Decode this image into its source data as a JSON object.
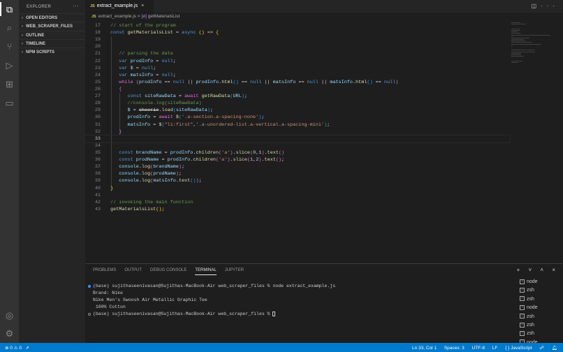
{
  "activity": {
    "items": [
      "explorer",
      "search",
      "source-control",
      "run-debug",
      "extensions",
      "remote"
    ],
    "account": "account",
    "settings": "settings"
  },
  "sidebar": {
    "title": "EXPLORER",
    "more": "···",
    "sections": [
      "OPEN EDITORS",
      "WEB_SCRAPER_FILES",
      "OUTLINE",
      "TIMELINE",
      "NPM SCRIPTS"
    ]
  },
  "tab": {
    "icon": "JS",
    "label": "extract_example.js",
    "close": "×"
  },
  "breadcrumb": {
    "file": "extract_example.js",
    "sep": ">",
    "symbol_icon": "[ø]",
    "symbol": "getMaterialsList"
  },
  "editor": {
    "current_line": 33,
    "lines": [
      {
        "n": "17",
        "t": [
          [
            "c",
            "// start of the program"
          ]
        ]
      },
      {
        "n": "18",
        "t": [
          [
            "k",
            "const "
          ],
          [
            "f",
            "getMaterialsList"
          ],
          [
            "p",
            " = "
          ],
          [
            "k",
            "async "
          ],
          [
            "y",
            "()"
          ],
          [
            "p",
            " => "
          ],
          [
            "y",
            "{"
          ]
        ]
      },
      {
        "n": "19",
        "t": []
      },
      {
        "n": "20",
        "t": []
      },
      {
        "n": "21",
        "t": [
          [
            "p",
            "   "
          ],
          [
            "c",
            "// parsing the data"
          ]
        ]
      },
      {
        "n": "22",
        "t": [
          [
            "p",
            "   "
          ],
          [
            "k",
            "var "
          ],
          [
            "v",
            "prodInfo"
          ],
          [
            "p",
            " = "
          ],
          [
            "k",
            "null"
          ],
          [
            "p",
            ";"
          ]
        ]
      },
      {
        "n": "23",
        "t": [
          [
            "p",
            "   "
          ],
          [
            "k",
            "var "
          ],
          [
            "v",
            "$"
          ],
          [
            "p",
            " = "
          ],
          [
            "k",
            "null"
          ],
          [
            "p",
            ";"
          ]
        ]
      },
      {
        "n": "24",
        "t": [
          [
            "p",
            "   "
          ],
          [
            "k",
            "var "
          ],
          [
            "v",
            "matsInfo"
          ],
          [
            "p",
            " = "
          ],
          [
            "k",
            "null"
          ],
          [
            "p",
            ";"
          ]
        ]
      },
      {
        "n": "25",
        "t": [
          [
            "p",
            "   "
          ],
          [
            "m",
            "while "
          ],
          [
            "m",
            "("
          ],
          [
            "v",
            "prodInfo"
          ],
          [
            "p",
            " == "
          ],
          [
            "k",
            "null"
          ],
          [
            "p",
            " || "
          ],
          [
            "v",
            "prodInfo"
          ],
          [
            "p",
            "."
          ],
          [
            "f",
            "html"
          ],
          [
            "b",
            "()"
          ],
          [
            "p",
            " == "
          ],
          [
            "k",
            "null"
          ],
          [
            "p",
            " || "
          ],
          [
            "v",
            "matsInfo"
          ],
          [
            "p",
            " == "
          ],
          [
            "k",
            "null"
          ],
          [
            "p",
            " || "
          ],
          [
            "v",
            "matsInfo"
          ],
          [
            "p",
            "."
          ],
          [
            "f",
            "html"
          ],
          [
            "b",
            "()"
          ],
          [
            "p",
            " == "
          ],
          [
            "k",
            "null"
          ],
          [
            "m",
            ")"
          ]
        ]
      },
      {
        "n": "26",
        "t": [
          [
            "p",
            "   "
          ],
          [
            "m",
            "{"
          ]
        ]
      },
      {
        "n": "27",
        "t": [
          [
            "p",
            "      "
          ],
          [
            "k",
            "const "
          ],
          [
            "v",
            "siteRawData"
          ],
          [
            "p",
            " = "
          ],
          [
            "m",
            "await "
          ],
          [
            "f",
            "getRawData"
          ],
          [
            "b",
            "("
          ],
          [
            "v",
            "URL"
          ],
          [
            "b",
            ")"
          ],
          [
            "p",
            ";"
          ]
        ]
      },
      {
        "n": "28",
        "t": [
          [
            "p",
            "      "
          ],
          [
            "c",
            "//console.log(siteRawData)"
          ]
        ]
      },
      {
        "n": "29",
        "t": [
          [
            "p",
            "      "
          ],
          [
            "v",
            "$"
          ],
          [
            "p",
            " = "
          ],
          [
            "st",
            "cheerio"
          ],
          [
            "p",
            "."
          ],
          [
            "f",
            "load"
          ],
          [
            "b",
            "("
          ],
          [
            "v",
            "siteRawData"
          ],
          [
            "b",
            ")"
          ],
          [
            "p",
            ";"
          ]
        ]
      },
      {
        "n": "30",
        "t": [
          [
            "p",
            "      "
          ],
          [
            "v",
            "prodInfo"
          ],
          [
            "p",
            " = "
          ],
          [
            "m",
            "await "
          ],
          [
            "f",
            "$"
          ],
          [
            "b",
            "("
          ],
          [
            "s",
            "'.a-section.a-spacing-none'"
          ],
          [
            "b",
            ")"
          ],
          [
            "p",
            ";"
          ]
        ]
      },
      {
        "n": "31",
        "t": [
          [
            "p",
            "      "
          ],
          [
            "v",
            "matsInfo"
          ],
          [
            "p",
            " = "
          ],
          [
            "f",
            "$"
          ],
          [
            "b",
            "("
          ],
          [
            "s",
            "\"li:first\""
          ],
          [
            "p",
            ","
          ],
          [
            "s",
            "'.a-unordered-list.a-vertical.a-spacing-mini'"
          ],
          [
            "b",
            ")"
          ],
          [
            "p",
            ";"
          ]
        ]
      },
      {
        "n": "32",
        "t": [
          [
            "p",
            "   "
          ],
          [
            "m",
            "}"
          ]
        ]
      },
      {
        "n": "33",
        "t": []
      },
      {
        "n": "34",
        "t": []
      },
      {
        "n": "35",
        "t": [
          [
            "p",
            "   "
          ],
          [
            "k",
            "const "
          ],
          [
            "v",
            "brandName"
          ],
          [
            "p",
            " = "
          ],
          [
            "v",
            "prodInfo"
          ],
          [
            "p",
            "."
          ],
          [
            "f",
            "children"
          ],
          [
            "m",
            "("
          ],
          [
            "s",
            "'a'"
          ],
          [
            "m",
            ")"
          ],
          [
            "p",
            "."
          ],
          [
            "f",
            "slice"
          ],
          [
            "m",
            "("
          ],
          [
            "p",
            "0,1"
          ],
          [
            "m",
            ")"
          ],
          [
            "p",
            "."
          ],
          [
            "f",
            "text"
          ],
          [
            "m",
            "()"
          ]
        ]
      },
      {
        "n": "36",
        "t": [
          [
            "p",
            "   "
          ],
          [
            "k",
            "const "
          ],
          [
            "v",
            "prodName"
          ],
          [
            "p",
            " = "
          ],
          [
            "v",
            "prodInfo"
          ],
          [
            "p",
            "."
          ],
          [
            "f",
            "children"
          ],
          [
            "m",
            "("
          ],
          [
            "s",
            "'a'"
          ],
          [
            "m",
            ")"
          ],
          [
            "p",
            "."
          ],
          [
            "f",
            "slice"
          ],
          [
            "m",
            "("
          ],
          [
            "p",
            "1,2"
          ],
          [
            "m",
            ")"
          ],
          [
            "p",
            "."
          ],
          [
            "f",
            "text"
          ],
          [
            "m",
            "()"
          ],
          [
            "p",
            ";"
          ]
        ]
      },
      {
        "n": "37",
        "t": [
          [
            "p",
            "   "
          ],
          [
            "v",
            "console"
          ],
          [
            "p",
            "."
          ],
          [
            "f",
            "log"
          ],
          [
            "m",
            "("
          ],
          [
            "v",
            "brandName"
          ],
          [
            "m",
            ")"
          ],
          [
            "p",
            ";"
          ]
        ]
      },
      {
        "n": "38",
        "t": [
          [
            "p",
            "   "
          ],
          [
            "v",
            "console"
          ],
          [
            "p",
            "."
          ],
          [
            "f",
            "log"
          ],
          [
            "m",
            "("
          ],
          [
            "v",
            "prodName"
          ],
          [
            "m",
            ")"
          ],
          [
            "p",
            ";"
          ]
        ]
      },
      {
        "n": "39",
        "t": [
          [
            "p",
            "   "
          ],
          [
            "v",
            "console"
          ],
          [
            "p",
            "."
          ],
          [
            "f",
            "log"
          ],
          [
            "m",
            "("
          ],
          [
            "v",
            "matsInfo"
          ],
          [
            "p",
            "."
          ],
          [
            "f",
            "text"
          ],
          [
            "b",
            "()"
          ],
          [
            "m",
            ")"
          ],
          [
            "p",
            ";"
          ]
        ]
      },
      {
        "n": "40",
        "t": [
          [
            "y",
            "}"
          ]
        ]
      },
      {
        "n": "41",
        "t": []
      },
      {
        "n": "42",
        "t": [
          [
            "c",
            "// invoking the main function"
          ]
        ]
      },
      {
        "n": "43",
        "t": [
          [
            "f",
            "getMaterialsList"
          ],
          [
            "y",
            "()"
          ],
          [
            "p",
            ";"
          ]
        ]
      }
    ]
  },
  "panel": {
    "tabs": [
      "PROBLEMS",
      "OUTPUT",
      "DEBUG CONSOLE",
      "TERMINAL",
      "JUPYTER"
    ],
    "active": "TERMINAL",
    "actions": "+ ˅ ˄ ×",
    "terminal": [
      {
        "dot": "#3794ff",
        "text": "(base) sujithaseenivasan@Sujithas-MacBook-Air web_scraper_files % node extract_example.js"
      },
      {
        "dot": "",
        "text": "Brand: Nike"
      },
      {
        "dot": "",
        "text": "Nike Men's Swoosh Air Metallic Graphic Tee"
      },
      {
        "dot": "",
        "text": " 100% Cotton"
      },
      {
        "dot": "#888",
        "text": "(base) sujithaseenivasan@Sujithas-MacBook-Air web_scraper_files % ",
        "cursor": true
      }
    ],
    "terminals": [
      "node",
      "zsh",
      "zsh",
      "node",
      "zsh",
      "zsh",
      "zsh",
      "node"
    ]
  },
  "status": {
    "errors": "0",
    "warnings": "0",
    "position": "Ln 33, Col 1",
    "spaces": "Spaces: 3",
    "encoding": "UTF-8",
    "eol": "LF",
    "language": "{ } JavaScript"
  },
  "colors": {
    "status_bar": "#007acc",
    "editor_bg": "#1e1e1e",
    "sidebar_bg": "#252526",
    "activity_bg": "#333333"
  }
}
